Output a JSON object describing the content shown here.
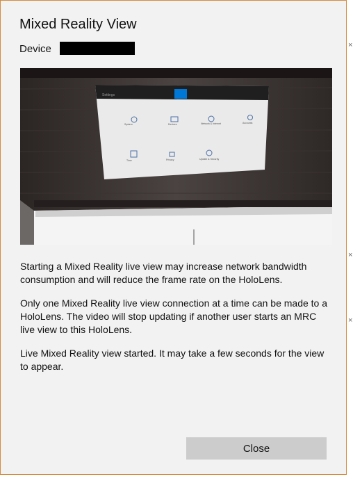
{
  "dialog": {
    "title": "Mixed Reality View",
    "device_label": "Device",
    "device_value": ""
  },
  "preview": {
    "settings_title": "Settings",
    "tiles": [
      "System",
      "Devices",
      "Network & Internet",
      "Accounts",
      "Time",
      "Privacy",
      "Update & Security"
    ]
  },
  "messages": {
    "bandwidth": "Starting a Mixed Reality live view may increase network bandwidth consumption and will reduce the frame rate on the HoloLens.",
    "single_connection": "Only one Mixed Reality live view connection at a time can be made to a HoloLens. The video will stop updating if another user starts an MRC live view to this HoloLens.",
    "status": "Live Mixed Reality view started. It may take a few seconds for the view to appear."
  },
  "actions": {
    "close_label": "Close"
  },
  "colors": {
    "dialog_border": "#d68a3c",
    "button_bg": "#cccccc",
    "accent": "#0078d7"
  },
  "icons": [
    "close-icon",
    "close-icon",
    "close-icon"
  ]
}
